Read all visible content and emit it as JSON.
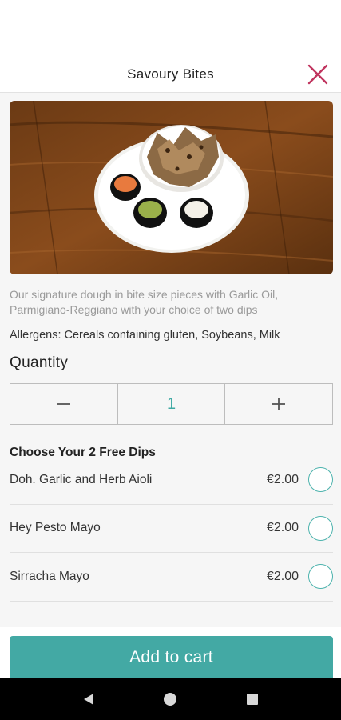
{
  "header": {
    "title": "Savoury Bites",
    "close_icon": "close-icon",
    "accent_color": "#c0345e"
  },
  "product": {
    "image_icon": "food-photo",
    "description": "Our signature dough in bite size pieces with  Garlic Oil, Parmigiano-Reggiano with your  choice of two dips",
    "allergens": "Allergens: Cereals containing gluten, Soybeans, Milk"
  },
  "quantity": {
    "label": "Quantity",
    "decrease": "−",
    "value": "1",
    "increase": "+"
  },
  "dips": {
    "title": "Choose Your 2 Free Dips",
    "items": [
      {
        "name": "Doh. Garlic and Herb Aioli",
        "price": "€2.00"
      },
      {
        "name": "Hey Pesto Mayo",
        "price": "€2.00"
      },
      {
        "name": "Sirracha Mayo",
        "price": "€2.00"
      }
    ]
  },
  "cart": {
    "label": "Add to cart",
    "color": "#43a9a4"
  },
  "nav": {
    "back_icon": "back-triangle-icon",
    "home_icon": "home-circle-icon",
    "recents_icon": "recents-square-icon"
  }
}
